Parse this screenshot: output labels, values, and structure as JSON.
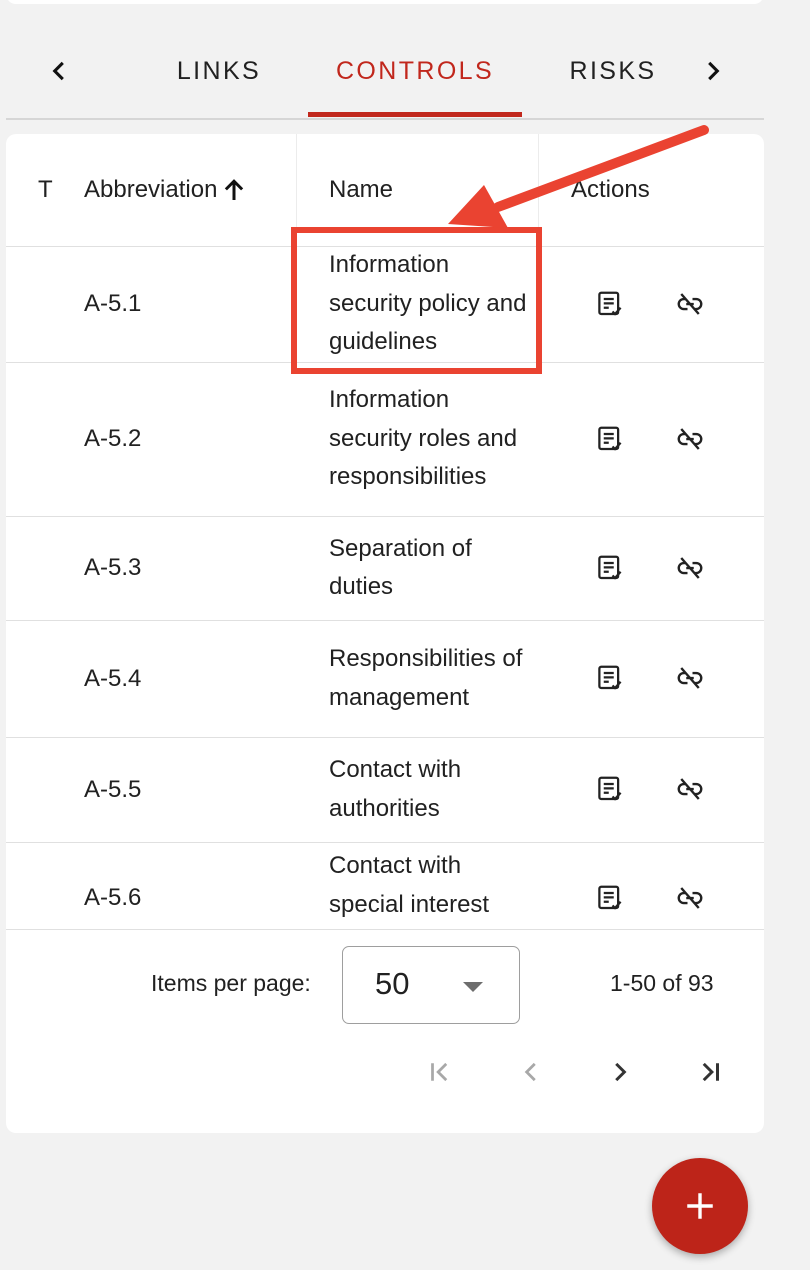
{
  "tabs": {
    "items": [
      {
        "label": "LINKS"
      },
      {
        "label": "CONTROLS",
        "active": true
      },
      {
        "label": "RISKS"
      }
    ],
    "prev_icon": "chevron-left-icon",
    "next_icon": "chevron-right-icon"
  },
  "table": {
    "headers": {
      "type": "T",
      "abbreviation": "Abbreviation",
      "name": "Name",
      "actions": "Actions"
    },
    "sort": {
      "column": "abbreviation",
      "direction": "ascending",
      "icon": "arrow-up-icon"
    },
    "rows": [
      {
        "abbreviation": "A-5.1",
        "name": "Information security policy and guidelines"
      },
      {
        "abbreviation": "A-5.2",
        "name": "Information security roles and responsibilities"
      },
      {
        "abbreviation": "A-5.3",
        "name": "Separation of duties"
      },
      {
        "abbreviation": "A-5.4",
        "name": "Responsibilities of management"
      },
      {
        "abbreviation": "A-5.5",
        "name": "Contact with authorities"
      },
      {
        "abbreviation": "A-5.6",
        "name": "Contact with special interest"
      }
    ],
    "row_actions": [
      "details-icon",
      "unlink-icon"
    ]
  },
  "paginator": {
    "items_per_page_label": "Items per page:",
    "page_size": "50",
    "range_label": "1-50 of 93"
  },
  "colors": {
    "accent": "#c1271c",
    "annotation": "#ea4331",
    "fab": "#bd2419"
  },
  "fab_icon": "plus-icon"
}
